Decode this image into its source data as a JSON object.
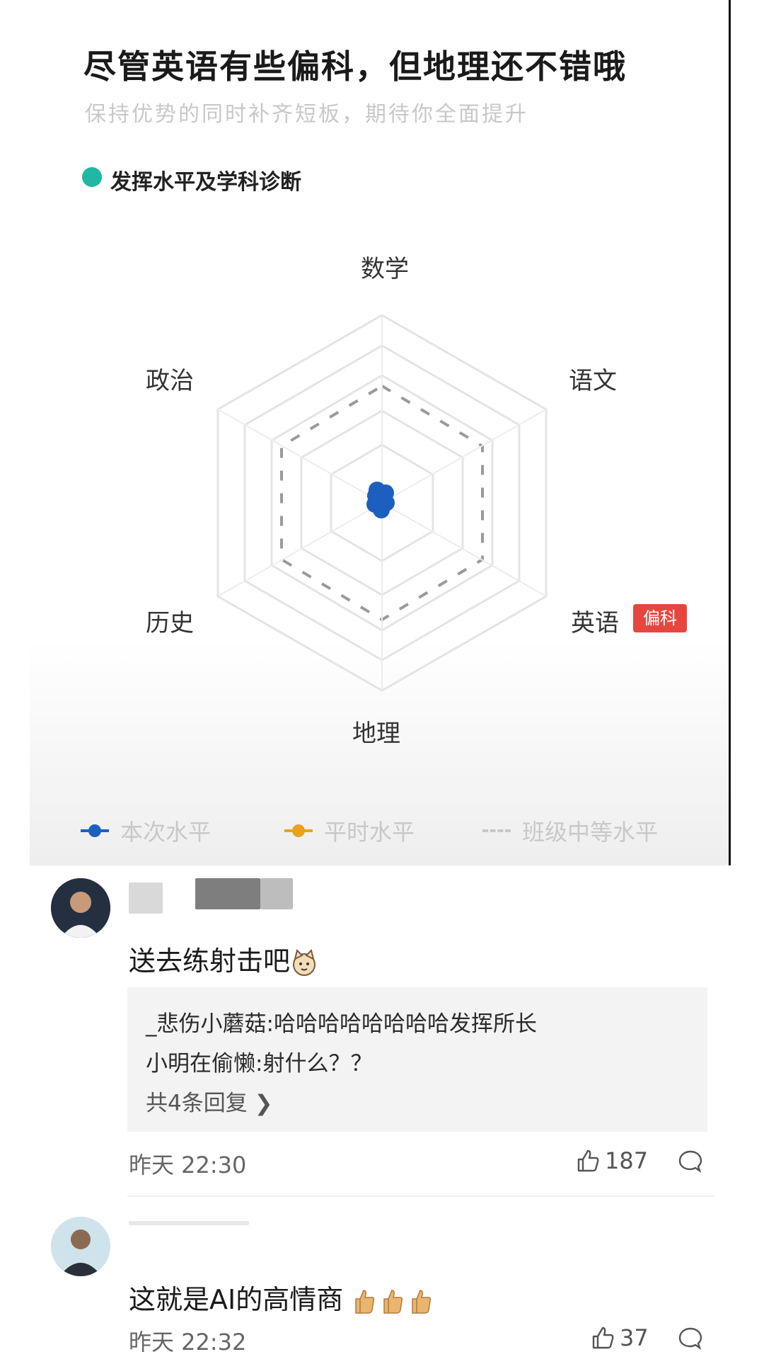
{
  "report": {
    "headline": "尽管英语有些偏科，但地理还不错哦",
    "subline": "保持优势的同时补齐短板，期待你全面提升",
    "section_title": "发挥水平及学科诊断",
    "axes": {
      "math": "数学",
      "chinese": "语文",
      "english": "英语",
      "geography": "地理",
      "history": "历史",
      "politics": "政治"
    },
    "bias_badge": "偏科",
    "legend": {
      "current": "本次水平",
      "usual": "平时水平",
      "class_median": "班级中等水平"
    },
    "colors": {
      "current": "#1c5fbf",
      "usual": "#e8a21d",
      "accent": "#20b7a4",
      "badge": "#e6463e"
    }
  },
  "comments": [
    {
      "text": "送去练射击吧",
      "emoji": "cat-face-icon",
      "replies": [
        "_悲伤小蘑菇:哈哈哈哈哈哈哈哈发挥所长",
        "小明在偷懒:射什么？？"
      ],
      "more_replies": "共4条回复",
      "time": "昨天 22:30",
      "likes": "187"
    },
    {
      "text": "这就是AI的高情商",
      "emoji": "thumbs-up-icon",
      "time": "昨天 22:32",
      "likes": "37"
    }
  ]
}
